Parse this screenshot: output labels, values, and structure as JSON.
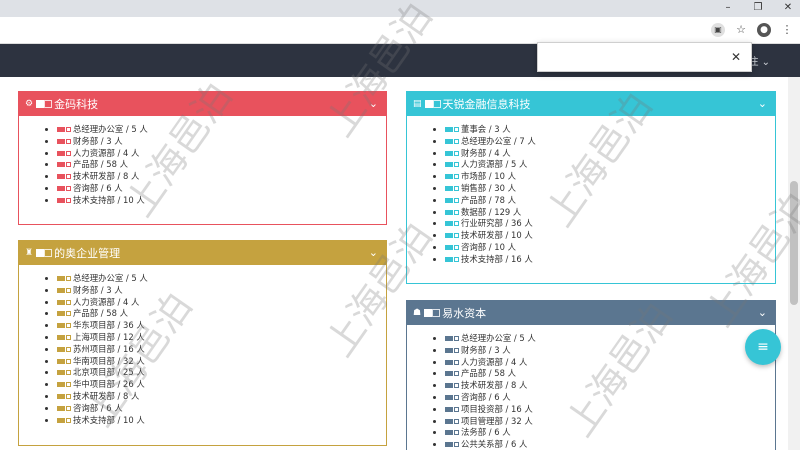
{
  "browser": {
    "minimize": "–",
    "restore": "❐",
    "close": "✕",
    "ext_icon": "▣",
    "star_icon": "☆",
    "profile_icon": "●",
    "menu_icon": "⋮"
  },
  "navbar": {
    "user_text": "注 ⌄"
  },
  "popup": {
    "close": "✕"
  },
  "cards": {
    "c1": {
      "title": "金码科技",
      "color": "#e8525d",
      "items": [
        "总经理办公室 / 5 人",
        "财务部 / 3 人",
        "人力资源部 / 4 人",
        "产品部 / 58 人",
        "技术研发部 / 8 人",
        "咨询部 / 6 人",
        "技术支持部 / 10 人"
      ]
    },
    "c2": {
      "title": "天锐金融信息科技",
      "color": "#36c5d6",
      "items": [
        "董事会 / 3 人",
        "总经理办公室 / 7 人",
        "财务部 / 4 人",
        "人力资源部 / 5 人",
        "市场部 / 10 人",
        "销售部 / 30 人",
        "产品部 / 78 人",
        "数据部 / 129 人",
        "行业研究部 / 36 人",
        "技术研发部 / 10 人",
        "咨询部 / 10 人",
        "技术支持部 / 16 人"
      ]
    },
    "c3": {
      "title": "的奥企业管理",
      "color": "#c5a23f",
      "items": [
        "总经理办公室 / 5 人",
        "财务部 / 3 人",
        "人力资源部 / 4 人",
        "产品部 / 58 人",
        "华东项目部 / 36 人",
        "上海项目部 / 12 人",
        "苏州项目部 / 16 人",
        "华南项目部 / 32 人",
        "北京项目部 / 25 人",
        "华中项目部 / 26 人",
        "技术研发部 / 8 人",
        "咨询部 / 6 人",
        "技术支持部 / 10 人"
      ]
    },
    "c4": {
      "title": "易水资本",
      "color": "#5b7690",
      "items": [
        "总经理办公室 / 5 人",
        "财务部 / 3 人",
        "人力资源部 / 4 人",
        "产品部 / 58 人",
        "技术研发部 / 8 人",
        "咨询部 / 6 人",
        "项目投资部 / 16 人",
        "项目管理部 / 32 人",
        "法务部 / 6 人",
        "公共关系部 / 6 人"
      ]
    }
  },
  "icons": {
    "card_chevron": "⌄",
    "fab": "≡"
  },
  "watermark": "上海邑泊"
}
